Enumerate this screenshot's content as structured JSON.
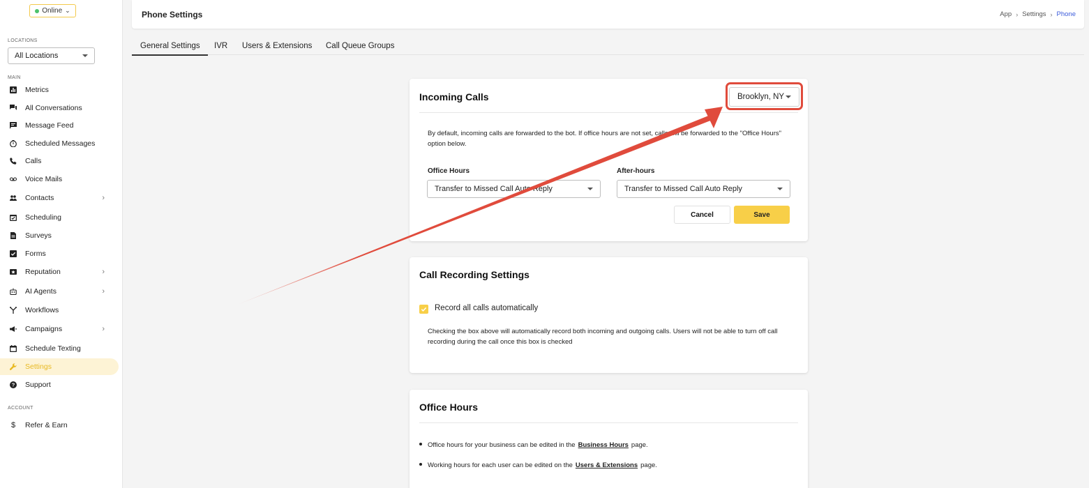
{
  "sidebar": {
    "status": "Online",
    "locations_label": "LOCATIONS",
    "location_select": "All Locations",
    "main_label": "MAIN",
    "account_label": "ACCOUNT",
    "items": [
      {
        "label": "Metrics",
        "icon": "bar-chart-icon"
      },
      {
        "label": "All Conversations",
        "icon": "chat-bubbles-icon"
      },
      {
        "label": "Message Feed",
        "icon": "message-icon"
      },
      {
        "label": "Scheduled Messages",
        "icon": "timer-icon"
      },
      {
        "label": "Calls",
        "icon": "phone-icon"
      },
      {
        "label": "Voice Mails",
        "icon": "voicemail-icon"
      },
      {
        "label": "Contacts",
        "icon": "people-icon"
      },
      {
        "label": "Scheduling",
        "icon": "calendar-check-icon"
      },
      {
        "label": "Surveys",
        "icon": "document-icon"
      },
      {
        "label": "Forms",
        "icon": "checkbox-icon"
      },
      {
        "label": "Reputation",
        "icon": "star-box-icon"
      },
      {
        "label": "AI Agents",
        "icon": "robot-icon"
      },
      {
        "label": "Workflows",
        "icon": "branch-icon"
      },
      {
        "label": "Campaigns",
        "icon": "megaphone-icon"
      },
      {
        "label": "Schedule Texting",
        "icon": "calendar-icon"
      },
      {
        "label": "Settings",
        "icon": "wrench-icon"
      },
      {
        "label": "Support",
        "icon": "help-icon"
      },
      {
        "label": "Refer & Earn",
        "icon": "dollar-icon"
      }
    ]
  },
  "header": {
    "title": "Phone Settings",
    "breadcrumb": [
      "App",
      "Settings",
      "Phone"
    ]
  },
  "tabs": [
    "General Settings",
    "IVR",
    "Users & Extensions",
    "Call Queue Groups"
  ],
  "incoming": {
    "title": "Incoming Calls",
    "location": "Brooklyn, NY",
    "description": "By default, incoming calls are forwarded to the bot. If office hours are not set, calls will be forwarded to the \"Office Hours\" option below.",
    "office_hours_label": "Office Hours",
    "office_hours_value": "Transfer to Missed Call Auto Reply",
    "after_hours_label": "After-hours",
    "after_hours_value": "Transfer to Missed Call Auto Reply",
    "cancel": "Cancel",
    "save": "Save"
  },
  "recording": {
    "title": "Call Recording Settings",
    "checkbox_label": "Record all calls automatically",
    "checked": true,
    "description": "Checking the box above will automatically record both incoming and outgoing calls. Users will not be able to turn off call recording during the call once this box is checked"
  },
  "office_hours": {
    "title": "Office Hours",
    "line1_pre": "Office hours for your business can be edited in the",
    "line1_link": "Business Hours",
    "line1_post": "page.",
    "line2_pre": "Working hours for each user can be edited on the",
    "line2_link": "Users & Extensions",
    "line2_post": "page."
  },
  "colors": {
    "accent": "#f8cf48",
    "annotation": "#e04b3c",
    "link": "#3b5bdb"
  }
}
